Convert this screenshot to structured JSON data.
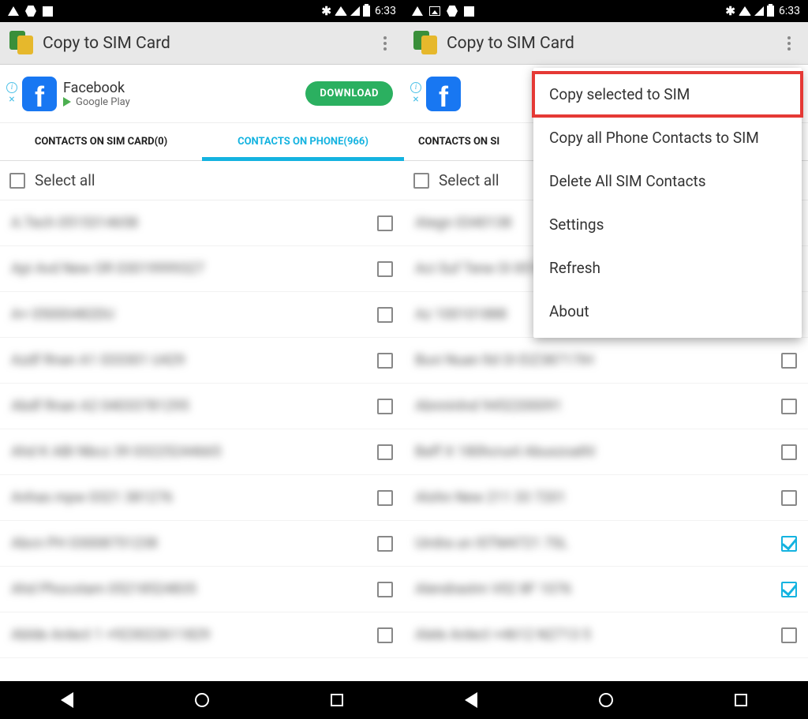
{
  "status": {
    "time": "6:33"
  },
  "app": {
    "title": "Copy to SIM Card"
  },
  "ad": {
    "title": "Facebook",
    "store": "Google Play",
    "button": "DOWNLOAD"
  },
  "tabs": {
    "sim": "CONTACTS ON SIM CARD(0)",
    "phone": "CONTACTS ON PHONE(966)",
    "sim_partial": "CONTACTS ON SI"
  },
  "list": {
    "select_all": "Select all",
    "contactsLeft": [
      {
        "text": "A.Tech  0515314658",
        "checked": false
      },
      {
        "text": "Api Avd New OR  03019999327",
        "checked": false
      },
      {
        "text": "A+  05000482DU",
        "checked": false
      },
      {
        "text": "Azdf Rnan A1  033301 U429",
        "checked": false
      },
      {
        "text": "Abdf Rnan A2  04033781295",
        "checked": false
      },
      {
        "text": "Ahd K ABI Nbcz 39  03225244665",
        "checked": false
      },
      {
        "text": "Anhas mpw  0321 381276",
        "checked": false
      },
      {
        "text": "Abcn PH  03008751238",
        "checked": false
      },
      {
        "text": "Ahd Phocotam  05218524835",
        "checked": false
      },
      {
        "text": "Ablde Anlect 1  +923022611829",
        "checked": false
      }
    ],
    "contactsRight": [
      {
        "text": "Ategn  0340138",
        "checked": false
      },
      {
        "text": "Aci Suf Tene OI  851818",
        "checked": false
      },
      {
        "text": "Az  100101888",
        "checked": false
      },
      {
        "text": "Buvi Nuan ltd OI  EIZ38717IH",
        "checked": false
      },
      {
        "text": "Abnninlnd  9452200091",
        "checked": false
      },
      {
        "text": "Baff X 180hcrunl  Abuxzoathl",
        "checked": false
      },
      {
        "text": "Alohn New 211 33 7201",
        "checked": false
      },
      {
        "text": "Uirdra un  ISTM4721 7SL",
        "checked": true
      },
      {
        "text": "Alendrastm  V02 8F 1076",
        "checked": true
      },
      {
        "text": "Alele Anlect  +4612 N2713 5",
        "checked": false
      }
    ]
  },
  "menu": {
    "items": [
      "Copy selected to SIM",
      "Copy all Phone Contacts to SIM",
      "Delete All SIM Contacts",
      "Settings",
      "Refresh",
      "About"
    ]
  }
}
